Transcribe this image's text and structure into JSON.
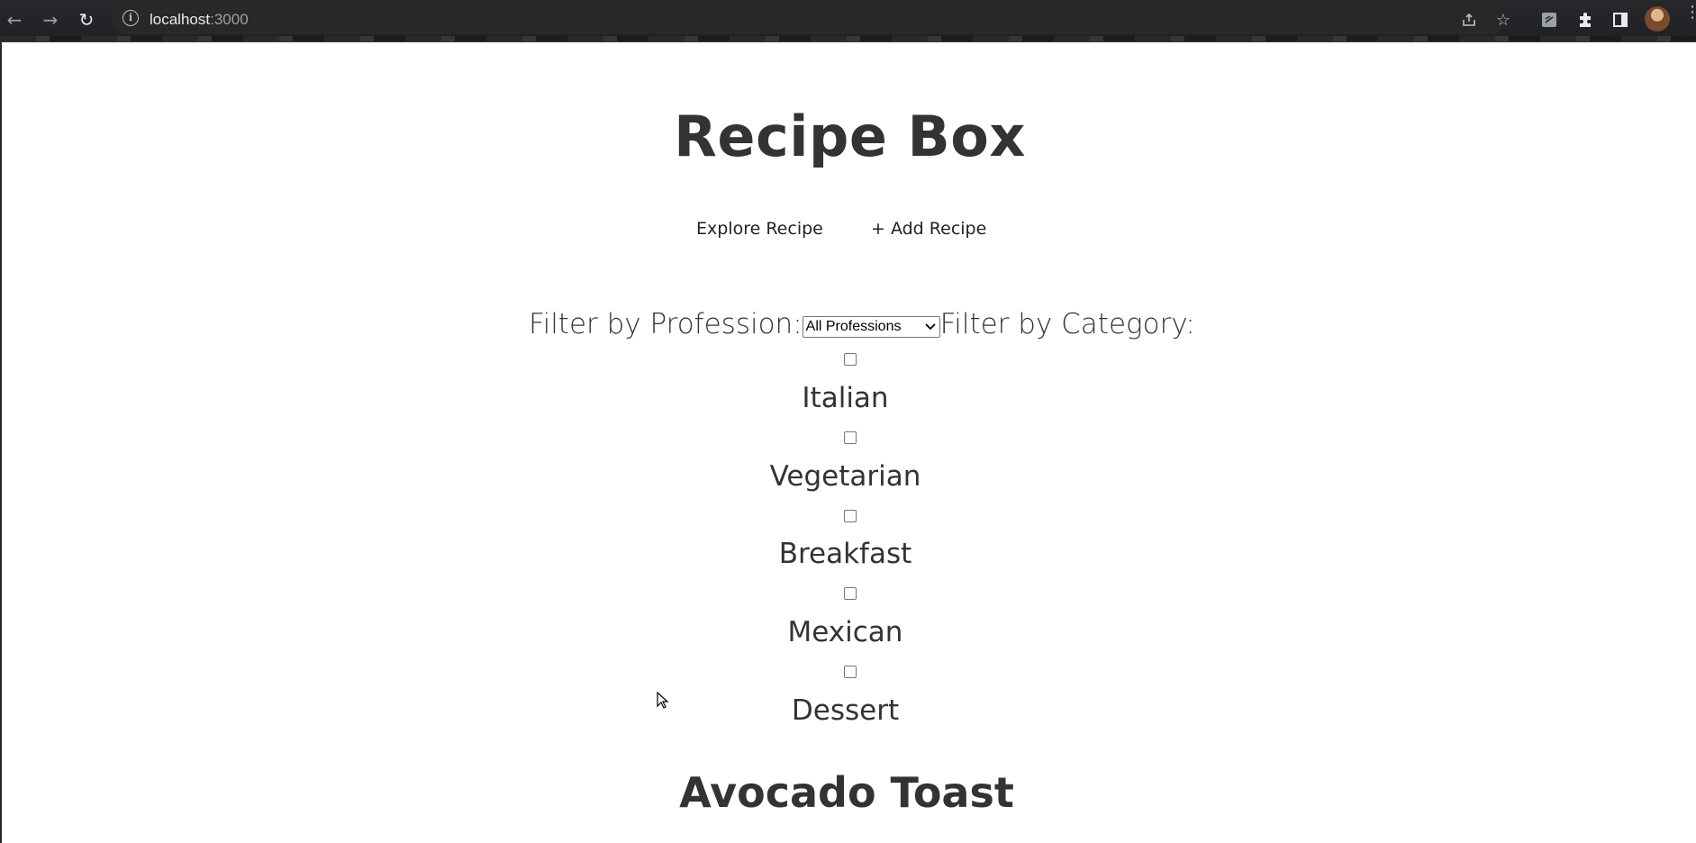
{
  "browser": {
    "url_host": "localhost",
    "url_port": ":3000"
  },
  "page": {
    "title": "Recipe Box",
    "nav": {
      "explore_label": "Explore Recipe",
      "add_label": "+ Add Recipe"
    },
    "filters": {
      "profession_label": "Filter by Profession:",
      "profession_selected": "All Professions",
      "category_label": "Filter by Category:"
    },
    "categories": [
      {
        "label": "Italian",
        "checked": false
      },
      {
        "label": "Vegetarian",
        "checked": false
      },
      {
        "label": "Breakfast",
        "checked": false
      },
      {
        "label": "Mexican",
        "checked": false
      },
      {
        "label": "Dessert",
        "checked": false
      }
    ],
    "first_recipe_title": "Avocado Toast"
  },
  "colors": {
    "text": "#333333",
    "chrome_bg": "#202124",
    "urlbar_bg": "#282828"
  }
}
